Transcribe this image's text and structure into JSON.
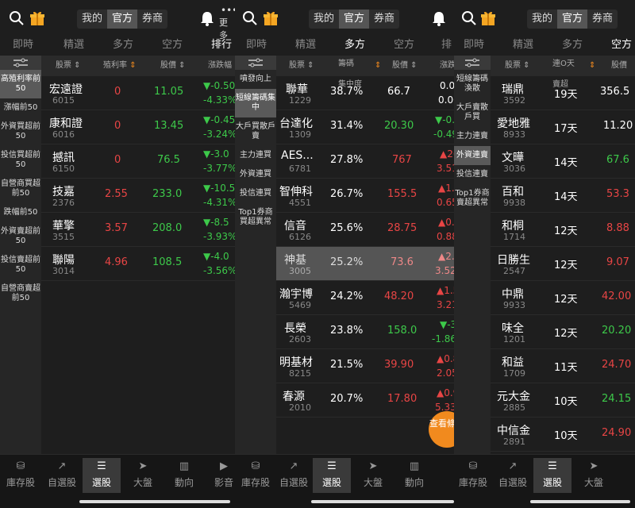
{
  "seg": {
    "mine": "我的",
    "official": "官方",
    "broker": "券商"
  },
  "more_label": "更多",
  "tabs": {
    "t1": "即時",
    "t2": "精選",
    "t3": "多方",
    "t4": "空方",
    "t5": "排行",
    "t5_partial": "排"
  },
  "p1": {
    "side": [
      {
        "label": "高殖利率前50"
      },
      {
        "label": "漲幅前50"
      },
      {
        "label": "外資買超前50"
      },
      {
        "label": "投信買超前50"
      },
      {
        "label": "自營商買超前50"
      },
      {
        "label": "跌幅前50"
      },
      {
        "label": "外資賣超前50"
      },
      {
        "label": "投信賣超前50"
      },
      {
        "label": "自營商賣超前50"
      }
    ],
    "headers": {
      "stock": "股票",
      "rate": "殖利率",
      "price": "股價",
      "chg": "漲跌幅"
    },
    "rows": [
      {
        "name": "宏遠證",
        "code": "6015",
        "rate": "0",
        "price": "11.05",
        "chg1": "▼-0.50",
        "chg2": "-4.33%"
      },
      {
        "name": "康和證",
        "code": "6016",
        "rate": "0",
        "price": "13.45",
        "chg1": "▼-0.45",
        "chg2": "-3.24%"
      },
      {
        "name": "撼訊",
        "code": "6150",
        "rate": "0",
        "price": "76.5",
        "chg1": "▼-3.0",
        "chg2": "-3.77%"
      },
      {
        "name": "技嘉",
        "code": "2376",
        "rate": "2.55",
        "price": "233.0",
        "chg1": "▼-10.5",
        "chg2": "-4.31%"
      },
      {
        "name": "華擎",
        "code": "3515",
        "rate": "3.57",
        "price": "208.0",
        "chg1": "▼-8.5",
        "chg2": "-3.93%"
      },
      {
        "name": "聯陽",
        "code": "3014",
        "rate": "4.96",
        "price": "108.5",
        "chg1": "▼-4.0",
        "chg2": "-3.56%"
      }
    ]
  },
  "p2": {
    "side": [
      {
        "label": "噴發向上"
      },
      {
        "label": "短線籌碼集中"
      },
      {
        "label": "大戶買散戶賣"
      },
      {
        "label": "主力連買"
      },
      {
        "label": "外資連買"
      },
      {
        "label": "投信連買"
      },
      {
        "label": "Top1券商買超異常"
      }
    ],
    "headers": {
      "stock": "股票",
      "conc1": "籌碼",
      "conc2": "集中度",
      "price": "股價",
      "chg": "漲跌"
    },
    "rows": [
      {
        "name": "聯華",
        "code": "1229",
        "conc": "38.7%",
        "price": "66.7",
        "chg1": "0.0",
        "chg2": "0.00"
      },
      {
        "name": "台達化",
        "code": "1309",
        "conc": "31.4%",
        "price": "20.30",
        "chg1": "▼-0.",
        "chg2": "-0.49"
      },
      {
        "name": "AES...",
        "code": "6781",
        "conc": "27.8%",
        "price": "767",
        "chg1": "▲26",
        "chg2": "3.51"
      },
      {
        "name": "智伸科",
        "code": "4551",
        "conc": "26.7%",
        "price": "155.5",
        "chg1": "▲1.0",
        "chg2": "0.65"
      },
      {
        "name": "信音",
        "code": "6126",
        "conc": "25.6%",
        "price": "28.75",
        "chg1": "▲0.2",
        "chg2": "0.88"
      },
      {
        "name": "神基",
        "code": "3005",
        "conc": "25.2%",
        "price": "73.6",
        "chg1": "▲2.",
        "chg2": "3.52"
      },
      {
        "name": "瀚宇博",
        "code": "5469",
        "conc": "24.2%",
        "price": "48.20",
        "chg1": "▲1.5",
        "chg2": "3.21"
      },
      {
        "name": "長榮",
        "code": "2603",
        "conc": "23.8%",
        "price": "158.0",
        "chg1": "▼-3",
        "chg2": "-1.86"
      },
      {
        "name": "明基材",
        "code": "8215",
        "conc": "21.5%",
        "price": "39.90",
        "chg1": "▲0.8",
        "chg2": "2.05"
      },
      {
        "name": "春源",
        "code": "2010",
        "conc": "20.7%",
        "price": "17.80",
        "chg1": "▲0.9",
        "chg2": "5.33"
      }
    ],
    "fab": "查看條件"
  },
  "p3": {
    "side": [
      {
        "label": "短線籌碼渙散"
      },
      {
        "label": "大戶賣散戶買"
      },
      {
        "label": "主力連賣"
      },
      {
        "label": "外資連賣"
      },
      {
        "label": "投信連賣"
      },
      {
        "label": "Top1券商賣超異常"
      }
    ],
    "headers": {
      "stock": "股票",
      "days1": "連O天",
      "days2": "賣超",
      "price": "股價"
    },
    "rows": [
      {
        "name": "瑞鼎",
        "code": "3592",
        "days": "19天",
        "price": "356.5"
      },
      {
        "name": "愛地雅",
        "code": "8933",
        "days": "17天",
        "price": "11.20"
      },
      {
        "name": "文曄",
        "code": "3036",
        "days": "14天",
        "price": "67.6"
      },
      {
        "name": "百和",
        "code": "9938",
        "days": "14天",
        "price": "53.3"
      },
      {
        "name": "和桐",
        "code": "1714",
        "days": "12天",
        "price": "8.88"
      },
      {
        "name": "日勝生",
        "code": "2547",
        "days": "12天",
        "price": "9.07"
      },
      {
        "name": "中鼎",
        "code": "9933",
        "days": "12天",
        "price": "42.00"
      },
      {
        "name": "味全",
        "code": "1201",
        "days": "12天",
        "price": "20.20"
      },
      {
        "name": "和益",
        "code": "1709",
        "days": "11天",
        "price": "24.70"
      },
      {
        "name": "元大金",
        "code": "2885",
        "days": "10天",
        "price": "24.15"
      },
      {
        "name": "中信金",
        "code": "2891",
        "days": "10天",
        "price": "24.90"
      }
    ]
  },
  "bottom": {
    "inv": "庫存股",
    "self": "自選股",
    "pick": "選股",
    "market": "大盤",
    "trend": "動向",
    "video": "影音"
  },
  "colors": {
    "red": "#e84545",
    "green": "#3dc94a",
    "orange": "#f18a1e"
  }
}
